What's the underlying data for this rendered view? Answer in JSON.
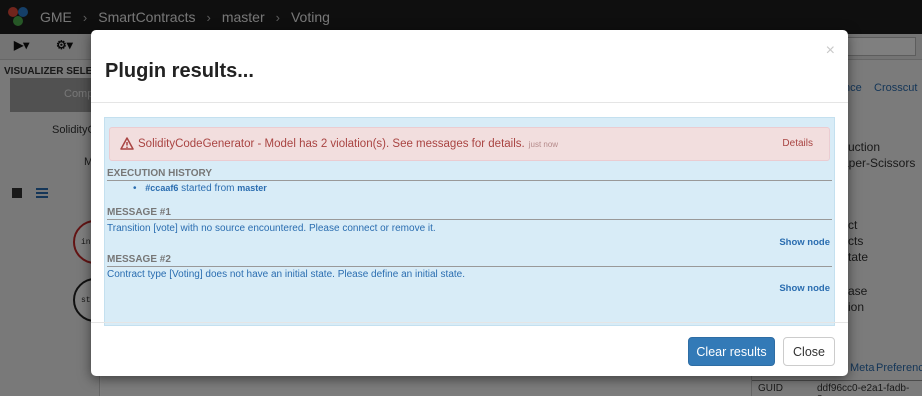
{
  "navbar": {
    "crumbs": [
      "GME",
      "SmartContracts",
      "master",
      "Voting"
    ],
    "separator": "›"
  },
  "toolbar": {
    "play_label": "▶▾",
    "dropdown_label": "⚙▾"
  },
  "left_panel": {
    "title": "VISUALIZER SELE",
    "active_item": "Comp",
    "items": [
      "SolidityC",
      "M"
    ]
  },
  "canvas": {
    "node_labels": [
      "ini",
      "st"
    ]
  },
  "right_panel": {
    "tabs": [
      "nce",
      "Crosscut"
    ],
    "lines": [
      "uction",
      "aper-Scissors",
      "ct",
      "cts",
      "tate",
      "ase",
      "ion"
    ],
    "bottom_tabs": [
      "Meta",
      "Preference"
    ],
    "guid_label": "GUID",
    "guid_value": "ddf96cc0-e2a1-fadb-8."
  },
  "modal": {
    "title": "Plugin results...",
    "close": "×",
    "alert": {
      "message": "SolidityCodeGenerator - Model has 2 violation(s). See messages for details.",
      "time": "just now",
      "details": "Details",
      "color": "#a94442"
    },
    "history": {
      "heading": "EXECUTION HISTORY",
      "bullet": "•",
      "hash": "#ccaaf6",
      "started": "started from",
      "branch": "master"
    },
    "messages": [
      {
        "heading": "MESSAGE #1",
        "text": "Transition [vote] with no source encountered. Please connect or remove it.",
        "action": "Show node"
      },
      {
        "heading": "MESSAGE #2",
        "text": "Contract type [Voting] does not have an initial state. Please define an initial state.",
        "action": "Show node"
      }
    ],
    "footer": {
      "clear_label": "Clear results",
      "close_label": "Close"
    }
  }
}
